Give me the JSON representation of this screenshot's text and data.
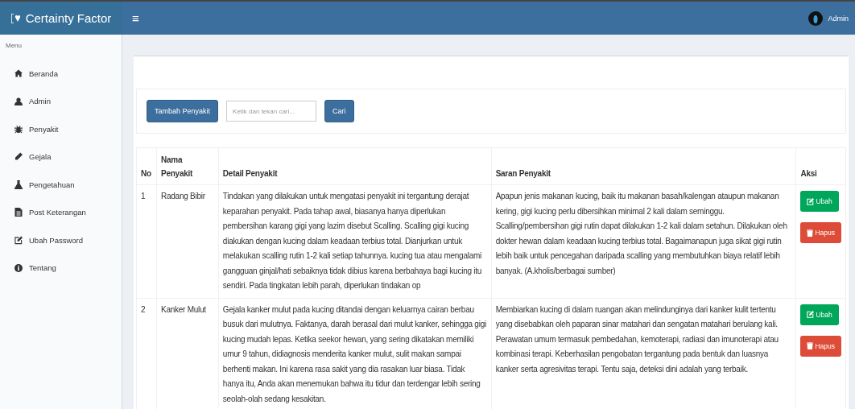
{
  "header": {
    "brand": "Certainty Factor",
    "menu_toggle": "≡",
    "user": "Admin"
  },
  "sidebar": {
    "heading": "Menu",
    "items": [
      {
        "label": "Beranda"
      },
      {
        "label": "Admin"
      },
      {
        "label": "Penyakit"
      },
      {
        "label": "Gejala"
      },
      {
        "label": "Pengetahuan"
      },
      {
        "label": "Post Keterangan"
      },
      {
        "label": "Ubah Password"
      },
      {
        "label": "Tentang"
      }
    ]
  },
  "toolbar": {
    "add_button": "Tambah Penyakit",
    "search": {
      "placeholder": "Ketik dan tekan cari..."
    },
    "search_button": "Cari"
  },
  "table": {
    "columns": [
      "No",
      "Nama Penyakit",
      "Detail Penyakit",
      "Saran Penyakit",
      "Aksi"
    ],
    "rows": [
      {
        "no": "1",
        "name": "Radang Bibir",
        "detail": "Tindakan yang dilakukan untuk mengatasi penyakit ini tergantung derajat keparahan penyakit. Pada tahap awal, biasanya hanya diperlukan pembersihan karang gigi yang lazim disebut Scalling. Scalling gigi kucing diakukan dengan kucing dalam keadaan terbius total. Dianjurkan untuk melakukan scalling rutin 1-2 kali setiap tahunnya. kucing tua atau mengalami gangguan ginjal/hati sebaiknya tidak dibius karena berbahaya bagi kucing itu sendiri. Pada tingkatan lebih parah, diperlukan tindakan op",
        "advice": "Apapun jenis makanan kucing, baik itu makanan basah/kalengan ataupun makanan kering, gigi kucing perlu dibersihkan minimal 2 kali dalam seminggu.\nScalling/pembersihan gigi rutin dapat dilakukan 1-2 kali dalam setahun. Dilakukan oleh dokter hewan dalam keadaan kucing terbius total. Bagaimanapun juga sikat gigi rutin lebih baik untuk pencegahan daripada scalling yang membutuhkan biaya relatif lebih banyak. (A.kholis/berbagai sumber)",
        "edit": "Ubah",
        "delete": "Hapus"
      },
      {
        "no": "2",
        "name": "Kanker Mulut",
        "detail": "Gejala kanker mulut pada kucing ditandai dengan keluarnya cairan berbau busuk dari mulutnya. Faktanya, darah berasal dari mulut kanker, sehingga gigi kucing mudah lepas. Ketika seekor hewan, yang sering dikatakan memiliki umur 9 tahun, didiagnosis menderita kanker mulut, sulit makan sampai berhenti makan. Ini karena rasa sakit yang dia rasakan luar biasa. Tidak hanya itu, Anda akan menemukan bahwa itu tidur dan terdengar lebih sering seolah-olah sedang kesakitan.",
        "advice": "Membiarkan kucing di dalam ruangan akan melindunginya dari kanker kulit tertentu yang disebabkan oleh paparan sinar matahari dan sengatan matahari berulang kali. Perawatan umum termasuk pembedahan, kemoterapi, radiasi dan imunoterapi atau kombinasi terapi. Keberhasilan pengobatan tergantung pada bentuk dan luasnya kanker serta agresivitas terapi. Tentu saja, deteksi dini adalah yang terbaik.",
        "edit": "Ubah",
        "delete": "Hapus"
      }
    ]
  }
}
